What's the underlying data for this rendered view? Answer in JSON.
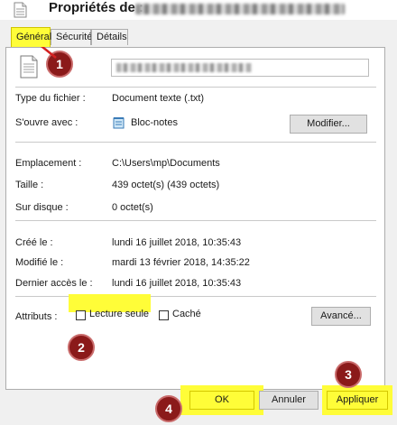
{
  "window": {
    "title": "Propriétés de :"
  },
  "tabs": [
    {
      "label": "Général",
      "active": true
    },
    {
      "label": "Sécurité",
      "active": false
    },
    {
      "label": "Détails",
      "active": false
    }
  ],
  "general": {
    "type_label": "Type du fichier :",
    "type_value": "Document texte (.txt)",
    "opens_label": "S'ouvre avec :",
    "opens_value": "Bloc-notes",
    "modify_button": "Modifier...",
    "location_label": "Emplacement :",
    "location_value": "C:\\Users\\mp\\Documents",
    "size_label": "Taille :",
    "size_value": "439 octet(s) (439 octets)",
    "disk_label": "Sur disque :",
    "disk_value": "0 octet(s)",
    "created_label": "Créé le :",
    "created_value": "lundi 16 juillet 2018, 10:35:43",
    "modified_label": "Modifié le :",
    "modified_value": "mardi 13 février 2018, 14:35:22",
    "accessed_label": "Dernier accès le :",
    "accessed_value": "lundi 16 juillet 2018, 10:35:43",
    "attributes_label": "Attributs :",
    "readonly_label": "Lecture seule",
    "readonly_checked": false,
    "hidden_label": "Caché",
    "hidden_checked": false,
    "advanced_button": "Avancé..."
  },
  "footer": {
    "ok": "OK",
    "cancel": "Annuler",
    "apply": "Appliquer"
  },
  "markers": [
    "1",
    "2",
    "3",
    "4"
  ],
  "colors": {
    "highlight": "#fffd38",
    "marker": "#8b1a1a",
    "arrow": "#d42020"
  },
  "icons": {
    "title": "text-file-icon",
    "file": "text-file-icon",
    "notepad": "notepad-icon"
  }
}
